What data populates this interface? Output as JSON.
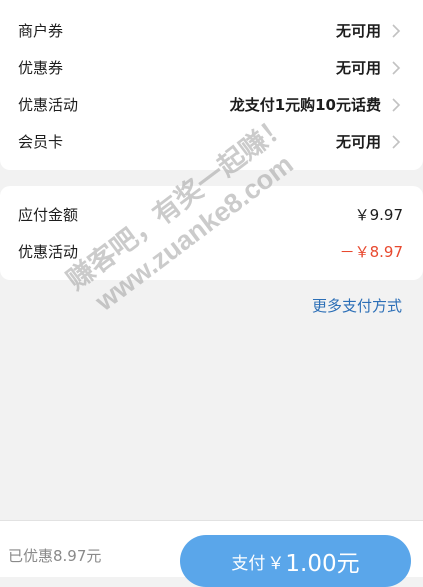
{
  "discounts": {
    "merchant_coupon": {
      "label": "商户券",
      "value": "无可用"
    },
    "coupon": {
      "label": "优惠券",
      "value": "无可用"
    },
    "promotion": {
      "label": "优惠活动",
      "value": "龙支付1元购10元话费"
    },
    "member_card": {
      "label": "会员卡",
      "value": "无可用"
    }
  },
  "amounts": {
    "payable": {
      "label": "应付金额",
      "value": "￥9.97"
    },
    "discount": {
      "label": "优惠活动",
      "value": "－￥8.97"
    }
  },
  "more_payment_label": "更多支付方式",
  "watermark": {
    "line1": "赚客吧，有奖一起赚！",
    "line2": "www.zuanke8.com"
  },
  "footer": {
    "saved_text": "已优惠8.97元",
    "pay_label": "支付",
    "currency": "￥",
    "amount": "1.00元"
  },
  "colors": {
    "accent_blue": "#5aa6ea",
    "link_blue": "#2c6fb7",
    "discount_red": "#e8492f"
  }
}
